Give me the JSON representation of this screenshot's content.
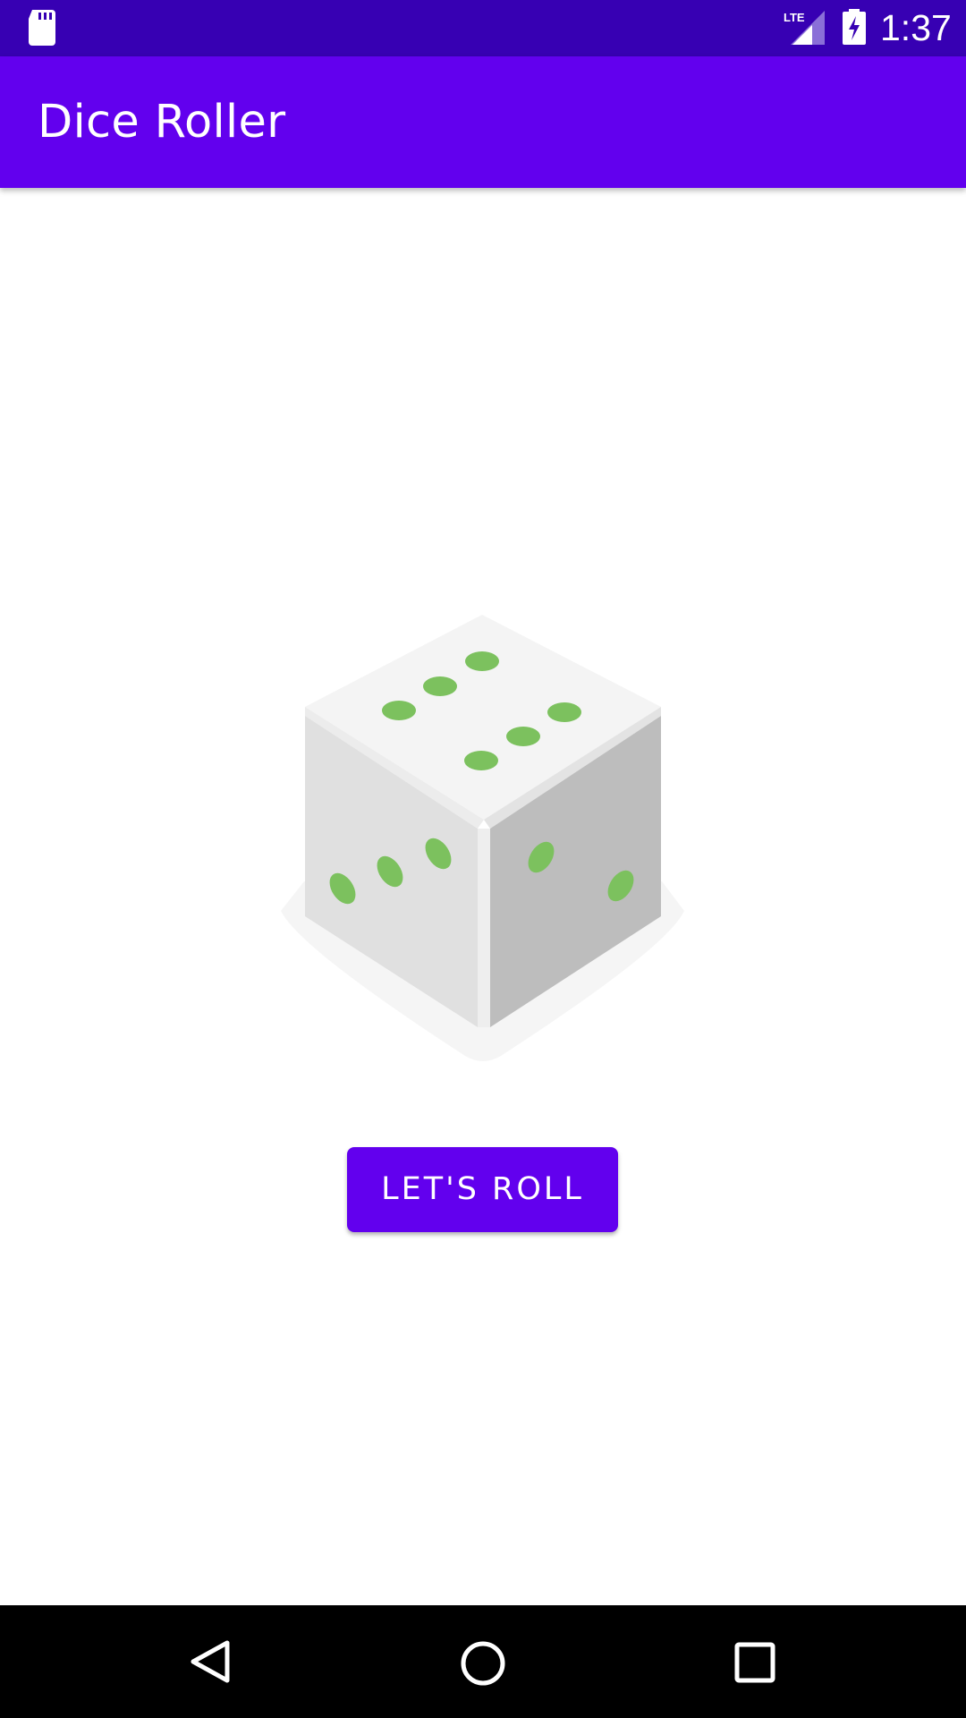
{
  "status_bar": {
    "time": "1:37",
    "network_label": "LTE",
    "icons": [
      "sd-card-icon",
      "lte-signal-icon",
      "battery-charging-icon"
    ]
  },
  "app_bar": {
    "title": "Dice Roller"
  },
  "dice": {
    "icon": "dice-image",
    "face_value": 6,
    "pip_color": "#7cc15e"
  },
  "roll_button": {
    "label": "LET'S ROLL"
  },
  "nav_bar": {
    "icons": [
      "back-icon",
      "home-icon",
      "recents-icon"
    ]
  },
  "colors": {
    "status_bar": "#3700b3",
    "primary": "#6200ee",
    "background": "#ffffff",
    "nav_bar": "#000000"
  }
}
